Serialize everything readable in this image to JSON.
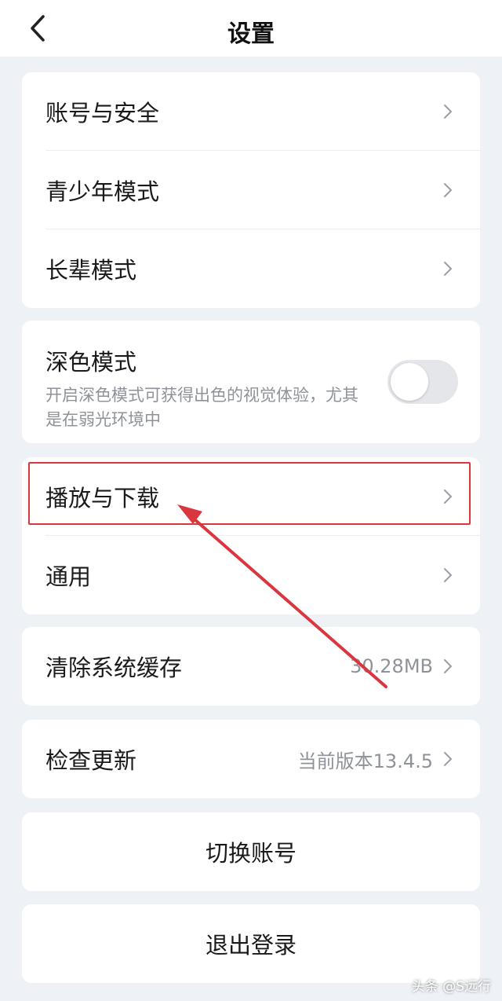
{
  "header": {
    "title": "设置",
    "back_icon": "chevron-left-icon"
  },
  "account_group": [
    {
      "label": "账号与安全"
    },
    {
      "label": "青少年模式"
    },
    {
      "label": "长辈模式"
    }
  ],
  "dark_mode": {
    "title": "深色模式",
    "description": "开启深色模式可获得出色的视觉体验，尤其是在弱光环境中",
    "enabled": false
  },
  "play_group": [
    {
      "label": "播放与下载"
    },
    {
      "label": "通用"
    }
  ],
  "cache": {
    "label": "清除系统缓存",
    "value": "30.28MB"
  },
  "update": {
    "label": "检查更新",
    "value": "当前版本13.4.5"
  },
  "switch_account": {
    "label": "切换账号"
  },
  "logout": {
    "label": "退出登录"
  },
  "watermark": "头条 @S远行",
  "colors": {
    "background": "#eef1f6",
    "card": "#ffffff",
    "annotation": "#d9363e",
    "secondary_text": "#8f9399"
  }
}
